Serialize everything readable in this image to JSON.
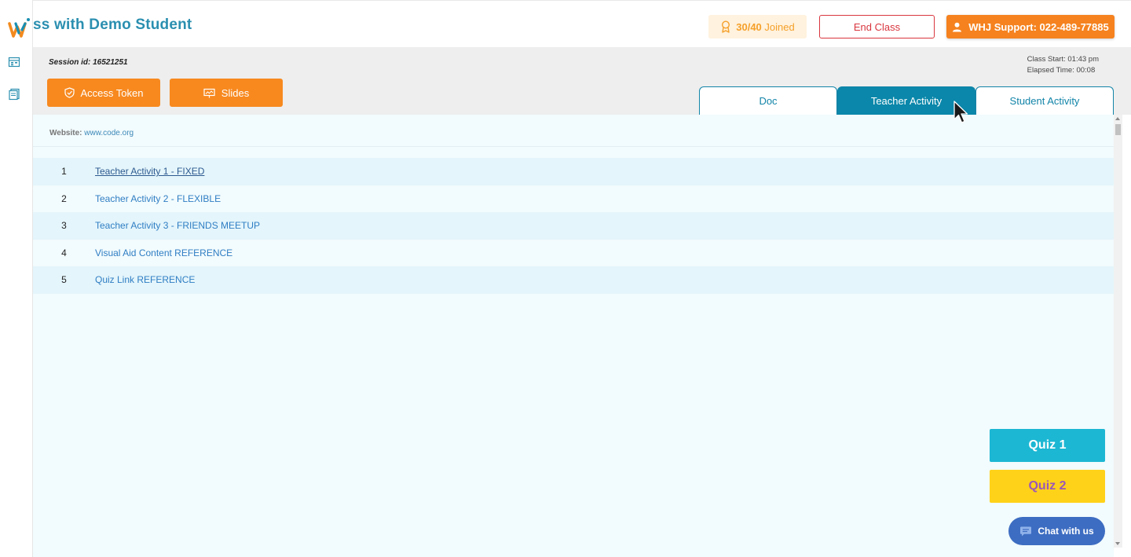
{
  "header": {
    "class_title": "ss with Demo Student",
    "joined": {
      "count": "30/40",
      "label": "Joined"
    },
    "end_class_label": "End Class",
    "support_label": "WHJ Support: 022-489-77885"
  },
  "session": {
    "session_id": "Session id: 16521251",
    "class_start": "Class Start: 01:43 pm",
    "elapsed_time": "Elapsed Time: 00:08"
  },
  "actions": {
    "access_token_label": "Access Token",
    "slides_label": "Slides"
  },
  "tabs": [
    {
      "label": "Doc",
      "active": false
    },
    {
      "label": "Teacher Activity",
      "active": true
    },
    {
      "label": "Student Activity",
      "active": false
    }
  ],
  "content": {
    "website_label": "Website:",
    "website_value": "www.code.org",
    "activities": [
      {
        "num": "1",
        "title": "Teacher Activity 1 - FIXED"
      },
      {
        "num": "2",
        "title": "Teacher Activity 2 - FLEXIBLE"
      },
      {
        "num": "3",
        "title": "Teacher Activity 3 - FRIENDS MEETUP"
      },
      {
        "num": "4",
        "title": "Visual Aid Content REFERENCE"
      },
      {
        "num": "5",
        "title": "Quiz Link REFERENCE"
      }
    ]
  },
  "quiz": {
    "quiz1_label": "Quiz 1",
    "quiz2_label": "Quiz 2"
  },
  "chat": {
    "label": "Chat with us"
  },
  "colors": {
    "brand_teal": "#2b8fb0",
    "orange": "#f7891f",
    "tab_active": "#0a87aa",
    "danger": "#d9363e",
    "quiz1": "#1cb7d3",
    "quiz2": "#ffd21a",
    "chat": "#3d6dc2"
  },
  "icons": {
    "logo": "whj-logo-icon",
    "sidebar": [
      "calendar-icon",
      "notes-icon"
    ],
    "joined": "award-icon",
    "support": "user-icon",
    "access_token": "shield-check-icon",
    "slides": "presentation-icon",
    "chat": "chat-bubble-icon"
  }
}
